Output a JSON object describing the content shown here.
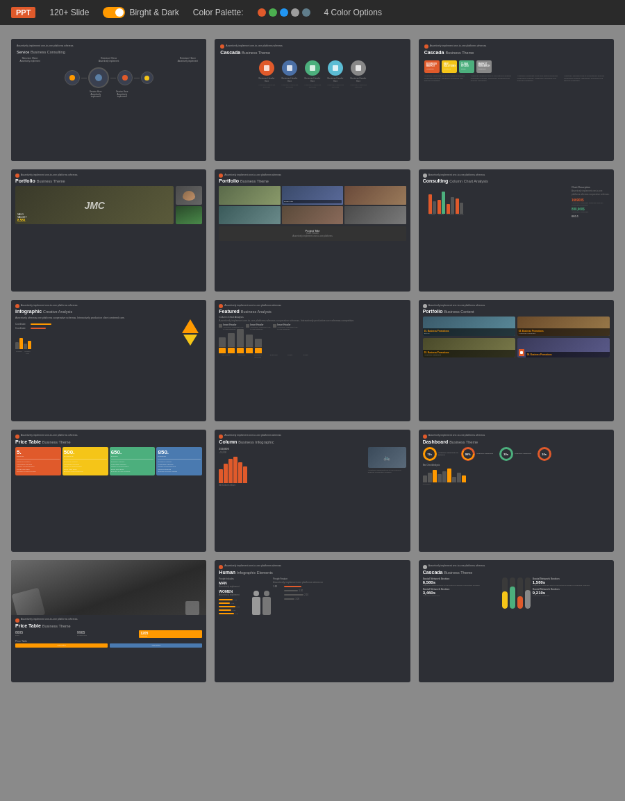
{
  "topbar": {
    "badge": "PPT",
    "slides": "120+ Slide",
    "theme": "Birght & Dark",
    "palette_label": "Color Palette:",
    "color_options": "4 Color Options",
    "colors": [
      "#e05a2b",
      "#4caf50",
      "#2196f3",
      "#9c27b0",
      "#607d8b"
    ]
  },
  "slides": [
    {
      "id": "slide-1",
      "label": "Service",
      "subtitle": "Business Consulting",
      "type": "service-circles"
    },
    {
      "id": "slide-2",
      "label": "Cascada",
      "subtitle": "Business Theme",
      "type": "cascada-circles"
    },
    {
      "id": "slide-3",
      "label": "Cascada",
      "subtitle": "Business Theme",
      "type": "cascada-boxes"
    },
    {
      "id": "slide-4",
      "label": "Portfolio",
      "subtitle": "Business Theme",
      "type": "portfolio-dark"
    },
    {
      "id": "slide-5",
      "label": "Portfolio",
      "subtitle": "Business Theme",
      "type": "portfolio-grid"
    },
    {
      "id": "slide-6",
      "label": "Consulting",
      "subtitle": "Column Chart Analysis",
      "type": "consulting-chart"
    },
    {
      "id": "slide-7",
      "label": "Infographic",
      "subtitle": "Creative Analysis",
      "type": "infographic"
    },
    {
      "id": "slide-8",
      "label": "Featured",
      "subtitle": "Business Analysis",
      "type": "featured-bars"
    },
    {
      "id": "slide-9",
      "label": "Portfolio",
      "subtitle": "Business Content",
      "type": "portfolio-content"
    },
    {
      "id": "slide-10",
      "label": "Price Table",
      "subtitle": "Business Theme",
      "type": "price-table"
    },
    {
      "id": "slide-11",
      "label": "Column",
      "subtitle": "Business Infographic",
      "type": "column-chart"
    },
    {
      "id": "slide-12",
      "label": "Dashboard",
      "subtitle": "Business Theme",
      "type": "dashboard"
    },
    {
      "id": "slide-13",
      "label": "Price Table",
      "subtitle": "Business Theme",
      "type": "photo-price"
    },
    {
      "id": "slide-14",
      "label": "Human",
      "subtitle": "Infographic Elements",
      "type": "human"
    },
    {
      "id": "slide-15",
      "label": "Cascada",
      "subtitle": "Business Theme",
      "type": "cascada-thermo"
    }
  ]
}
